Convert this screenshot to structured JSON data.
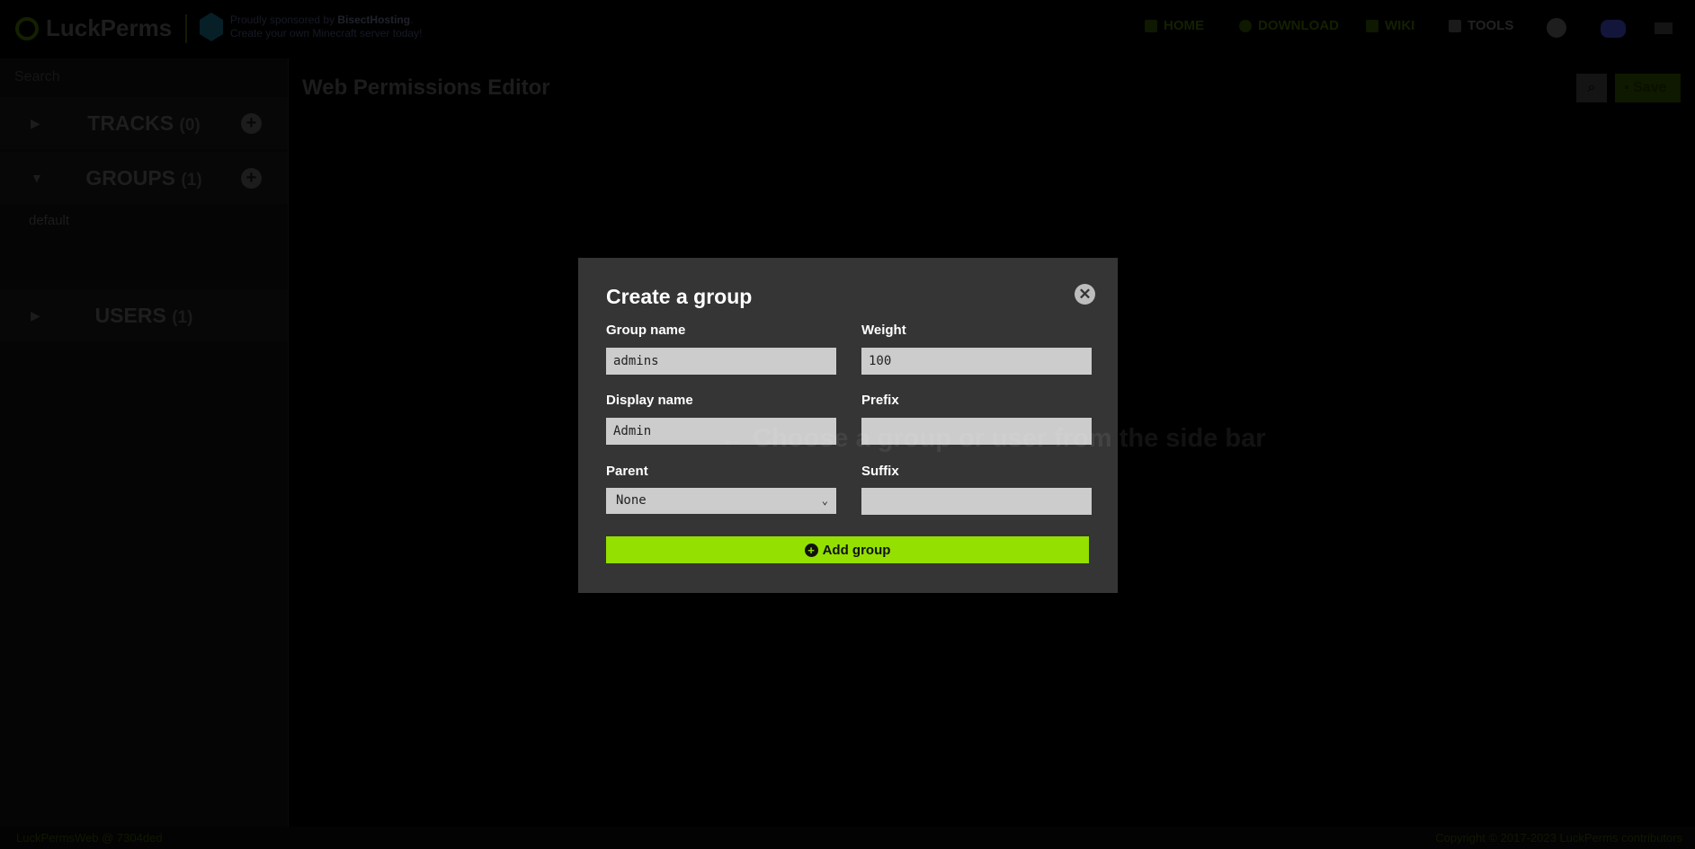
{
  "header": {
    "brand": "LuckPerms",
    "sponsor_line1_prefix": "Proudly sponsored by ",
    "sponsor_name": "BisectHosting",
    "sponsor_line1_suffix": ".",
    "sponsor_line2": "Create your own Minecraft server today!",
    "nav": [
      {
        "label": "HOME",
        "icon": "home-icon"
      },
      {
        "label": "DOWNLOAD",
        "icon": "download-icon"
      },
      {
        "label": "WIKI",
        "icon": "book-icon"
      },
      {
        "label": "TOOLS",
        "icon": "tools-icon"
      }
    ]
  },
  "editor": {
    "title": "Web Permissions Editor",
    "save_label": "Save",
    "empty_message": "Choose a group or user from the side bar"
  },
  "sidebar": {
    "search_placeholder": "Search",
    "tracks": {
      "label": "TRACKS",
      "count": "(0)"
    },
    "groups": {
      "label": "GROUPS",
      "count": "(1)",
      "items": [
        "default"
      ]
    },
    "users": {
      "label": "USERS",
      "count": "(1)"
    }
  },
  "modal": {
    "title": "Create a group",
    "group_name_label": "Group name",
    "group_name_value": "admins",
    "weight_label": "Weight",
    "weight_value": "100",
    "display_name_label": "Display name",
    "display_name_value": "Admin",
    "prefix_label": "Prefix",
    "prefix_value": "",
    "parent_label": "Parent",
    "parent_value": "None",
    "suffix_label": "Suffix",
    "suffix_value": "",
    "add_label": "Add group"
  },
  "footer": {
    "version": "LuckPermsWeb @ 7304ded",
    "copyright": "Copyright © 2017-2023 LuckPerms contributors"
  },
  "colors": {
    "accent": "#94e000",
    "modal_bg": "#353535",
    "input_bg": "#cccccc"
  }
}
